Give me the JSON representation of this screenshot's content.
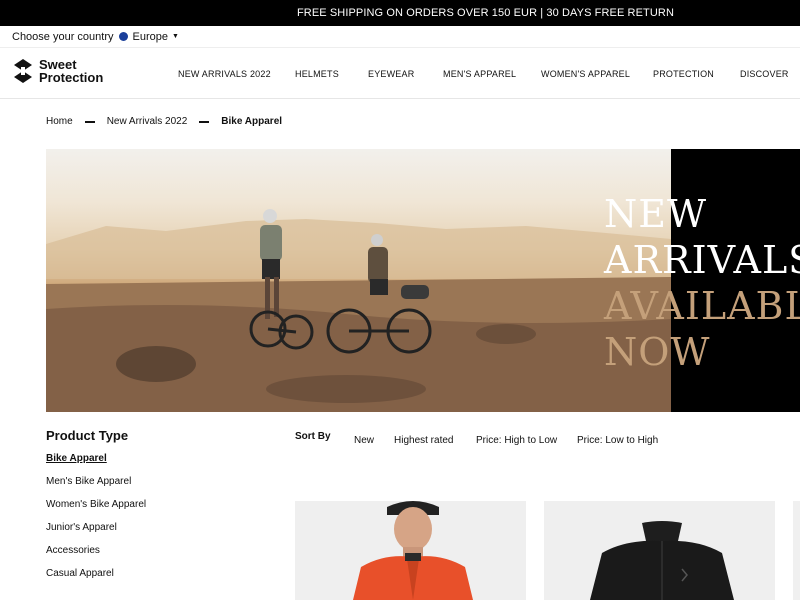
{
  "promo": {
    "text": "FREE SHIPPING ON ORDERS OVER 150 EUR | 30 DAYS FREE RETURN"
  },
  "country": {
    "label": "Choose your country",
    "selected": "Europe"
  },
  "brand": {
    "line1": "Sweet",
    "line2": "Protection"
  },
  "nav": {
    "items": [
      "NEW ARRIVALS 2022",
      "HELMETS",
      "EYEWEAR",
      "MEN'S APPAREL",
      "WOMEN'S APPAREL",
      "PROTECTION",
      "DISCOVER"
    ]
  },
  "breadcrumb": {
    "home": "Home",
    "parent": "New Arrivals 2022",
    "current": "Bike Apparel"
  },
  "hero": {
    "line1": "NEW",
    "line2": "ARRIVALS",
    "line3": "AVAILABLE",
    "line4": "NOW"
  },
  "filters": {
    "title": "Product Type",
    "items": [
      "Bike Apparel",
      "Men's Bike Apparel",
      "Women's Bike Apparel",
      "Junior's Apparel",
      "Accessories",
      "Casual Apparel"
    ],
    "active_index": 0
  },
  "sort": {
    "label": "Sort By",
    "options": [
      "New",
      "Highest rated",
      "Price: High to Low",
      "Price: Low to High"
    ]
  },
  "colors": {
    "accent_gold": "#c4a07a",
    "country_dot": "#1a3f9a",
    "jacket_orange": "#e8502a"
  }
}
